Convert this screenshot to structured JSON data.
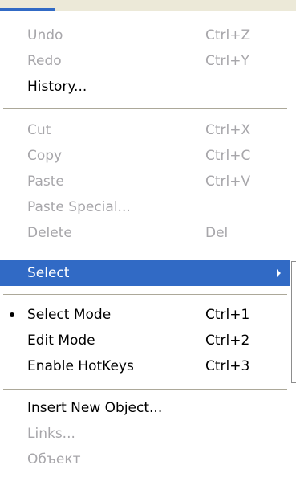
{
  "menu": {
    "undo": {
      "label": "Undo",
      "shortcut": "Ctrl+Z"
    },
    "redo": {
      "label": "Redo",
      "shortcut": "Ctrl+Y"
    },
    "history": {
      "label": "History..."
    },
    "cut": {
      "label": "Cut",
      "shortcut": "Ctrl+X"
    },
    "copy": {
      "label": "Copy",
      "shortcut": "Ctrl+C"
    },
    "paste": {
      "label": "Paste",
      "shortcut": "Ctrl+V"
    },
    "paste_special": {
      "label": "Paste Special..."
    },
    "delete": {
      "label": "Delete",
      "shortcut": "Del"
    },
    "select": {
      "label": "Select"
    },
    "select_mode": {
      "label": "Select Mode",
      "shortcut": "Ctrl+1"
    },
    "edit_mode": {
      "label": "Edit Mode",
      "shortcut": "Ctrl+2"
    },
    "enable_hotkeys": {
      "label": "Enable HotKeys",
      "shortcut": "Ctrl+3"
    },
    "insert_new_object": {
      "label": "Insert New Object..."
    },
    "links": {
      "label": "Links..."
    },
    "object": {
      "label": "Объект"
    }
  },
  "colors": {
    "highlight": "#316ac5",
    "disabled_text": "#a7a6aa",
    "separator": "#aca899"
  }
}
